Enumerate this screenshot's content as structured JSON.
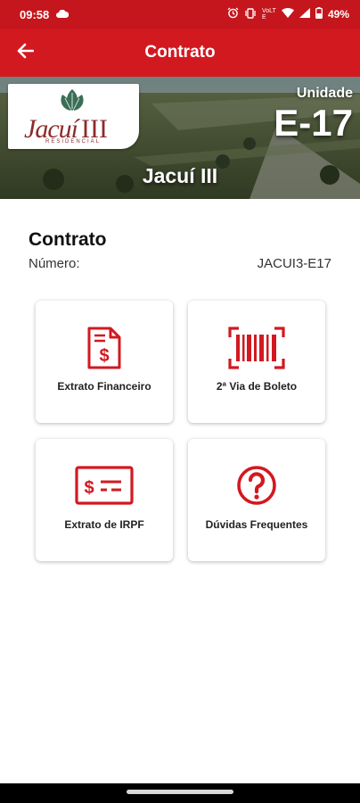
{
  "status_bar": {
    "time": "09:58",
    "network_text": "VoLTE",
    "battery": "49%"
  },
  "app_bar": {
    "title": "Contrato",
    "back_icon": "arrow-left-icon"
  },
  "hero": {
    "logo_text": "Jacuí",
    "logo_roman": "III",
    "logo_subtitle": "RESIDENCIAL",
    "unidade_label": "Unidade",
    "unidade_value": "E-17",
    "development_name": "Jacuí III"
  },
  "contract": {
    "section_title": "Contrato",
    "numero_label": "Número:",
    "numero_value": "JACUI3-E17"
  },
  "cards": [
    {
      "label": "Extrato Financeiro",
      "icon": "invoice-dollar-icon"
    },
    {
      "label": "2ª Via de Boleto",
      "icon": "barcode-icon"
    },
    {
      "label": "Extrato de IRPF",
      "icon": "check-dollar-icon"
    },
    {
      "label": "Dúvidas Frequentes",
      "icon": "question-circle-icon"
    }
  ],
  "colors": {
    "primary": "#d21920",
    "status_bar": "#c4161c",
    "icon": "#d21920"
  }
}
